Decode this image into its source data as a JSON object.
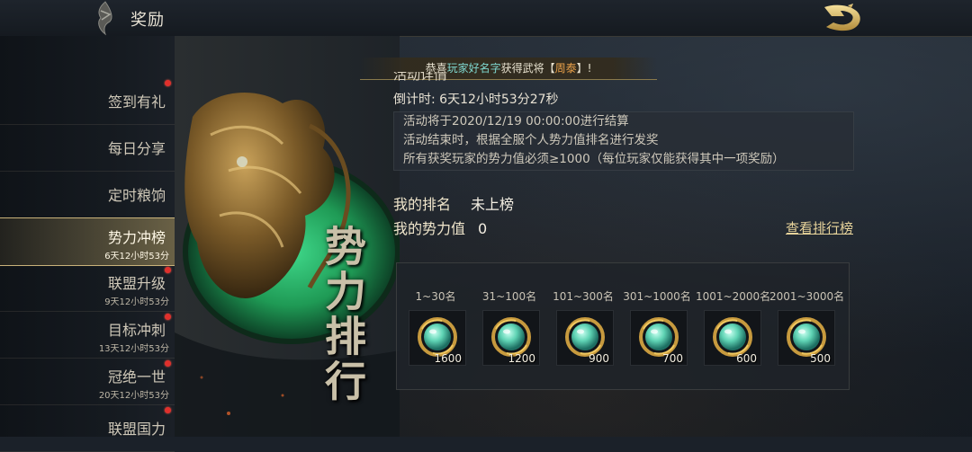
{
  "header": {
    "title": "奖励"
  },
  "sidebar": {
    "items": [
      {
        "label": "签到有礼",
        "sub": "",
        "dot": true,
        "active": false
      },
      {
        "label": "每日分享",
        "sub": "",
        "dot": false,
        "active": false
      },
      {
        "label": "定时粮饷",
        "sub": "",
        "dot": false,
        "active": false
      },
      {
        "label": "势力冲榜",
        "sub": "6天12小时53分",
        "dot": false,
        "active": true
      },
      {
        "label": "联盟升级",
        "sub": "9天12小时53分",
        "dot": true,
        "active": false
      },
      {
        "label": "目标冲刺",
        "sub": "13天12小时53分",
        "dot": true,
        "active": false
      },
      {
        "label": "冠绝一世",
        "sub": "20天12小时53分",
        "dot": true,
        "active": false
      },
      {
        "label": "联盟国力",
        "sub": "",
        "dot": true,
        "active": false
      }
    ]
  },
  "banner": {
    "title": "势力排行"
  },
  "announcement": {
    "prefix": "恭喜",
    "player": "玩家好名字",
    "middle": "获得武将【",
    "hero": "周泰",
    "suffix": "】!"
  },
  "details": {
    "section_title": "活动详情",
    "countdown": "倒计时: 6天12小时53分27秒",
    "rules": [
      "活动将于2020/12/19 00:00:00进行结算",
      "活动结束时，根据全服个人势力值排名进行发奖",
      "所有获奖玩家的势力值必须≥1000（每位玩家仅能获得其中一项奖励）"
    ],
    "my_rank_label": "我的排名",
    "my_rank_value": "未上榜",
    "my_power_label": "我的势力值",
    "my_power_value": "0",
    "view_rank_link": "查看排行榜"
  },
  "rewards": [
    {
      "range": "1~30名",
      "amount": "1600"
    },
    {
      "range": "31~100名",
      "amount": "1200"
    },
    {
      "range": "101~300名",
      "amount": "900"
    },
    {
      "range": "301~1000名",
      "amount": "700"
    },
    {
      "range": "1001~2000名",
      "amount": "600"
    },
    {
      "range": "2001~3000名",
      "amount": "500"
    }
  ],
  "colors": {
    "accent_gold": "#c9b27a",
    "badge_red": "#e0302c",
    "player_name": "#7fd8d0",
    "hero_name": "#e9a04a"
  }
}
